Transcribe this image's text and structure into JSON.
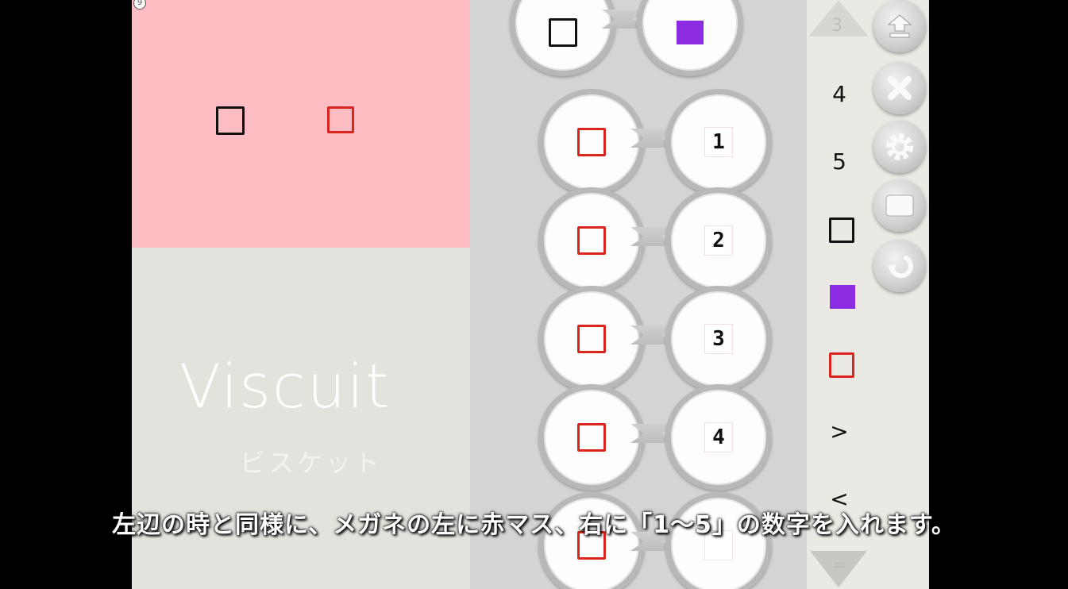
{
  "logo": {
    "title": "Viscuit",
    "subtitle": "ビスケット"
  },
  "stage": {
    "badge": "9"
  },
  "program": {
    "top_rule": {
      "left": "black-square",
      "right": "purple-square"
    },
    "rules": [
      {
        "left": "red-square",
        "right_number": "1"
      },
      {
        "left": "red-square",
        "right_number": "2"
      },
      {
        "left": "red-square",
        "right_number": "3"
      },
      {
        "left": "red-square",
        "right_number": "4"
      },
      {
        "left": "red-square",
        "right_number": ""
      }
    ]
  },
  "palette": {
    "scroll_up_label": "3",
    "items": [
      "4",
      "5",
      "black-square",
      "purple-square",
      "red-square",
      ">",
      "<"
    ],
    "scroll_down_label": "="
  },
  "tools": [
    "upload-icon",
    "close-icon",
    "gear-icon",
    "stage-icon",
    "undo-icon"
  ],
  "subtitle": "左辺の時と同様に、メガネの左に赤マス、右に「1〜5」の数字を入れます。",
  "colors": {
    "stage": "#fdbdc3",
    "red": "#d8261e",
    "purple": "#8b2be2"
  }
}
